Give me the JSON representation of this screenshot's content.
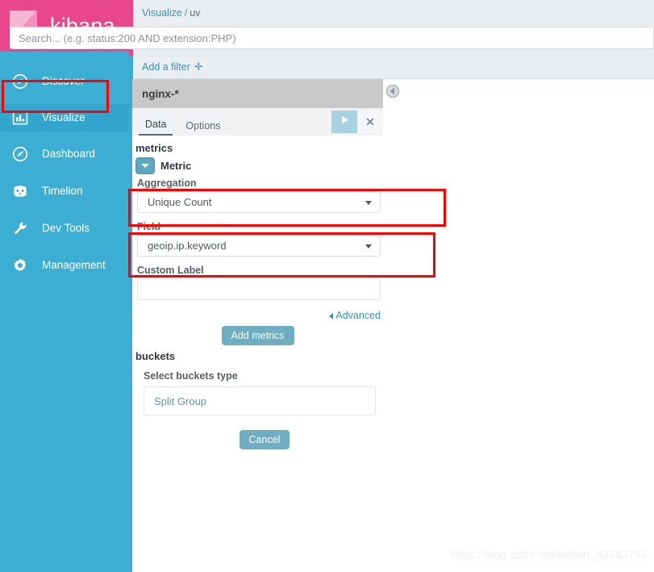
{
  "app": {
    "logo_text": "kibana"
  },
  "sidebar": {
    "items": [
      {
        "label": "Discover",
        "icon": "compass-icon",
        "active": false
      },
      {
        "label": "Visualize",
        "icon": "bar-chart-icon",
        "active": true
      },
      {
        "label": "Dashboard",
        "icon": "dashboard-icon",
        "active": false
      },
      {
        "label": "Timelion",
        "icon": "timelion-icon",
        "active": false
      },
      {
        "label": "Dev Tools",
        "icon": "wrench-icon",
        "active": false
      },
      {
        "label": "Management",
        "icon": "gear-icon",
        "active": false
      }
    ]
  },
  "topbar": {
    "breadcrumb_root": "Visualize",
    "breadcrumb_separator": "/",
    "breadcrumb_current": "uv",
    "search_placeholder": "Search... (e.g. status:200 AND extension:PHP)",
    "search_value": "",
    "add_filter_label": "Add a filter",
    "add_filter_plus": "✛"
  },
  "editor": {
    "index_pattern": "nginx-*",
    "tabs": [
      {
        "label": "Data",
        "active": true
      },
      {
        "label": "Options",
        "active": false
      }
    ],
    "apply_icon": "play-icon",
    "discard_icon": "close-icon",
    "discard_label": "✕",
    "collapse_icon": "chevron-left-circle-icon",
    "metrics_heading": "metrics",
    "metric_toggle_label": "Metric",
    "aggregation_label": "Aggregation",
    "aggregation_value": "Unique Count",
    "field_label": "Field",
    "field_value": "geoip.ip.keyword",
    "custom_label_label": "Custom Label",
    "custom_label_value": "",
    "custom_label_placeholder": "",
    "advanced_label": "Advanced",
    "add_metrics_label": "Add metrics",
    "buckets_heading": "buckets",
    "select_buckets_label": "Select buckets type",
    "buckets_value": "Split Group",
    "cancel_label": "Cancel"
  },
  "watermark": {
    "text": "https://blog.csdn.net/weixin_43342753"
  },
  "colors": {
    "brand_pink": "#e8488b",
    "sidebar_teal": "#3caed3",
    "sidebar_active": "#34a5cc",
    "accent_blue": "#3d8fb9",
    "button_blue": "#6eadc2",
    "highlight_red": "#ff0000",
    "panel_header_gray": "#c9c9c9"
  }
}
